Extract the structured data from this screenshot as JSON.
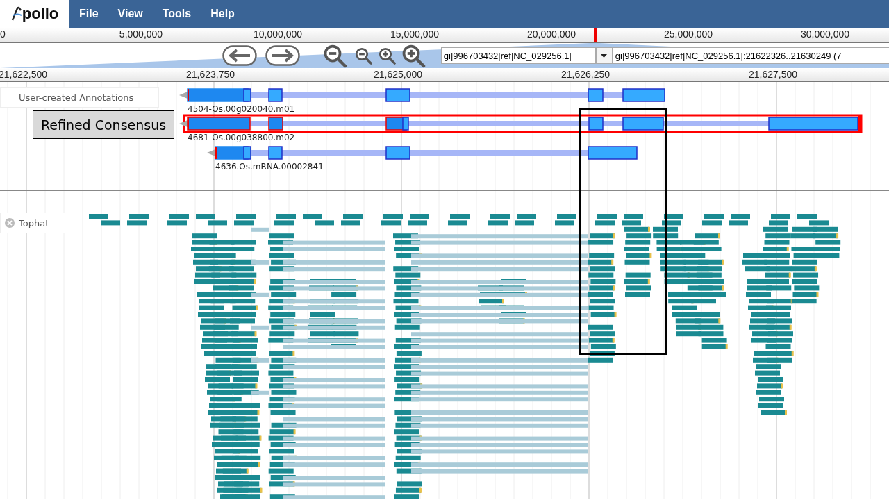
{
  "app": {
    "logo_text": "pollo"
  },
  "menu": [
    "File",
    "View",
    "Tools",
    "Help"
  ],
  "overview_ruler": {
    "ticks": [
      "0",
      "5,000,000",
      "10,000,000",
      "15,000,000",
      "20,000,000",
      "25,000,000",
      "30,000,000"
    ]
  },
  "navigation": {
    "sequence": "gi|996703432|ref|NC_029256.1|",
    "location": "gi|996703432|ref|NC_029256.1|:21622326..21630249 (7"
  },
  "detail_ruler": {
    "ticks": [
      "21,622,500",
      "21,623,750",
      "21,625,000",
      "21,626,250",
      "21,627,500"
    ]
  },
  "tracks": [
    {
      "label": "User-created Annotations",
      "kind": "annotations",
      "features": [
        {
          "name": "4504-Os.00g020040.m01",
          "selected": false
        },
        {
          "name": "4681-Os.00g038800.m02",
          "selected": true
        },
        {
          "name": "4636.Os.mRNA.00002841",
          "selected": false
        }
      ]
    },
    {
      "label": "Tophat",
      "kind": "alignments"
    }
  ],
  "callout": {
    "text": "Refined Consensus"
  }
}
